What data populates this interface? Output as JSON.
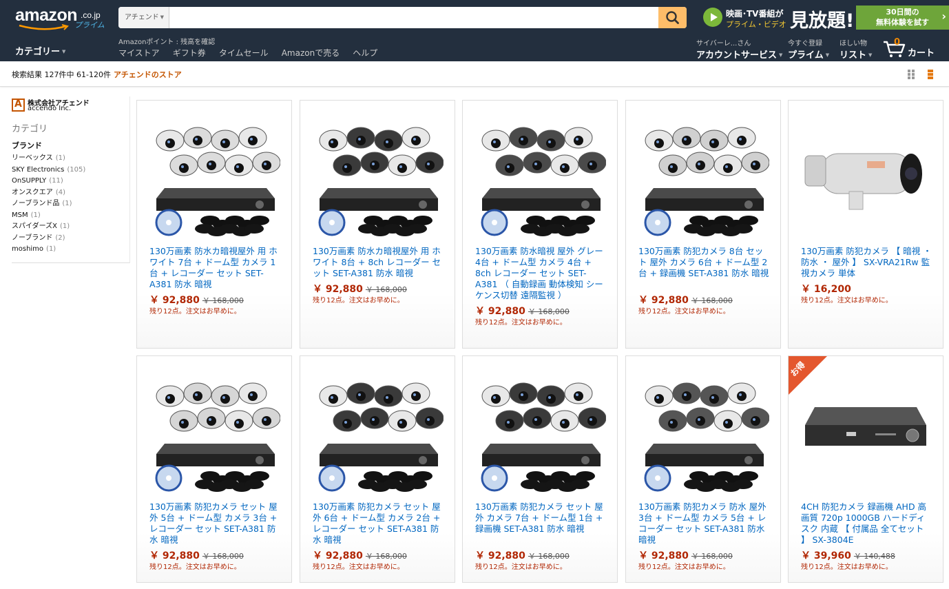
{
  "header": {
    "logo_text": "amazon",
    "logo_tld": ".co.jp",
    "logo_sub": "プライム",
    "search": {
      "dept_label": "アチェンド",
      "query": "",
      "placeholder": ""
    },
    "promo": {
      "line1": "映画･TV番組が",
      "line2": "プライム・ビデオ",
      "big": "見放題!",
      "cta_line1": "30日間の",
      "cta_line2": "無料体験を試す"
    },
    "categories_label": "カテゴリー",
    "points_text": "Amazonポイント : 残高を確認",
    "nav_links": [
      "マイストア",
      "ギフト券",
      "タイムセール",
      "Amazonで売る",
      "ヘルプ"
    ],
    "account": {
      "small": "サイバーレ...さん",
      "large": "アカウントサービス"
    },
    "prime": {
      "small": "今すぐ登録",
      "large": "プライム"
    },
    "wishlist": {
      "small": "ほしい物",
      "large": "リスト"
    },
    "cart": {
      "count": "0",
      "label": "カート"
    }
  },
  "subbar": {
    "results": "検索結果 127件中 61-120件",
    "store_link": "アチェンドのストア"
  },
  "sidebar": {
    "store_name_jp": "株式会社アチェンド",
    "store_name_en": "accendo Inc.",
    "heading": "カテゴリ",
    "brand_heading": "ブランド",
    "brands": [
      {
        "name": "リーベックス",
        "count": "(1)"
      },
      {
        "name": "SKY Electronics",
        "count": "(105)"
      },
      {
        "name": "OnSUPPLY",
        "count": "(11)"
      },
      {
        "name": "オンスクエア",
        "count": "(4)"
      },
      {
        "name": "ノーブランド品",
        "count": "(1)"
      },
      {
        "name": "MSM",
        "count": "(1)"
      },
      {
        "name": "スパイダーズX",
        "count": "(1)"
      },
      {
        "name": "ノーブランド",
        "count": "(2)"
      },
      {
        "name": "moshimo",
        "count": "(1)"
      }
    ]
  },
  "products": [
    {
      "title": "130万画素 防水カ暗視屋外 用 ホワイト 7台 + ドーム型 カメラ 1台 + レコーダー セット SET-A381 防水 暗視",
      "price": "￥ 92,880",
      "list_price": "￥ 168,000",
      "stock": "残り12点。注文はお早めに。",
      "image": "camera-kit",
      "body_color": "#dcdcdc",
      "deal": ""
    },
    {
      "title": "130万画素 防水カ暗視屋外 用 ホワイト 8台 + 8ch レコーダー セット SET-A381 防水 暗視",
      "price": "￥ 92,880",
      "list_price": "￥ 168,000",
      "stock": "残り12点。注文はお早めに。",
      "image": "camera-kit",
      "body_color": "#3a3a3a",
      "deal": ""
    },
    {
      "title": "130万画素 防水暗視 屋外 グレー 4台 + ドーム型 カメラ 4台 + 8ch レコーダー セット SET-A381 （ 自動録画 動体検知 シーケンス切替 遠隔監視 ）",
      "price": "￥ 92,880",
      "list_price": "￥ 168,000",
      "stock": "残り12点。注文はお早めに。",
      "image": "camera-kit",
      "body_color": "#4a4a4a",
      "deal": ""
    },
    {
      "title": "130万画素 防犯カメラ 8台 セット 屋外 カメラ 6台 + ドーム型 2台 + 録画機 SET-A381 防水 暗視",
      "price": "￥ 92,880",
      "list_price": "￥ 168,000",
      "stock": "残り12点。注文はお早めに。",
      "image": "camera-kit",
      "body_color": "#d0d0d0",
      "deal": ""
    },
    {
      "title": "130万画素 防犯カメラ 【 暗視 ・ 防水 ・ 屋外 】 SX-VRA21Rw 監視カメラ 単体",
      "price": "￥ 16,200",
      "list_price": "",
      "stock": "残り12点。注文はお早めに。",
      "image": "single-camera",
      "body_color": "#dedede",
      "deal": ""
    },
    {
      "title": "130万画素 防犯カメラ セット 屋外 5台 + ドーム型 カメラ 3台 + レコーダー セット SET-A381 防水 暗視",
      "price": "￥ 92,880",
      "list_price": "￥ 168,000",
      "stock": "残り12点。注文はお早めに。",
      "image": "camera-kit",
      "body_color": "#d6d6d6",
      "deal": ""
    },
    {
      "title": "130万画素 防犯カメラ セット 屋外 6台 + ドーム型 カメラ 2台 + レコーダー セット SET-A381 防水 暗視",
      "price": "￥ 92,880",
      "list_price": "￥ 168,000",
      "stock": "残り12点。注文はお早めに。",
      "image": "camera-kit",
      "body_color": "#3a3a3a",
      "deal": ""
    },
    {
      "title": "130万画素 防犯カメラ セット 屋外 カメラ 7台 + ドーム型 1台 + 録画機 SET-A381 防水 暗視",
      "price": "￥ 92,880",
      "list_price": "￥ 168,000",
      "stock": "残り12点。注文はお早めに。",
      "image": "camera-kit",
      "body_color": "#3a3a3a",
      "deal": ""
    },
    {
      "title": "130万画素 防犯カメラ 防水 屋外 3台 + ドーム型 カメラ 5台 + レコーダー セット SET-A381 防水 暗視",
      "price": "￥ 92,880",
      "list_price": "￥ 168,000",
      "stock": "残り12点。注文はお早めに。",
      "image": "camera-kit",
      "body_color": "#555555",
      "deal": ""
    },
    {
      "title": "4CH 防犯カメラ 録画機 AHD 高画質 720p 1000GB ハードディスク 内蔵 【 付属品 全てセット 】 SX-3804E",
      "price": "￥ 39,960",
      "list_price": "￥ 140,488",
      "stock": "残り12点。注文はお早めに。",
      "image": "recorder",
      "body_color": "#2e2e2e",
      "deal": "お得"
    }
  ]
}
